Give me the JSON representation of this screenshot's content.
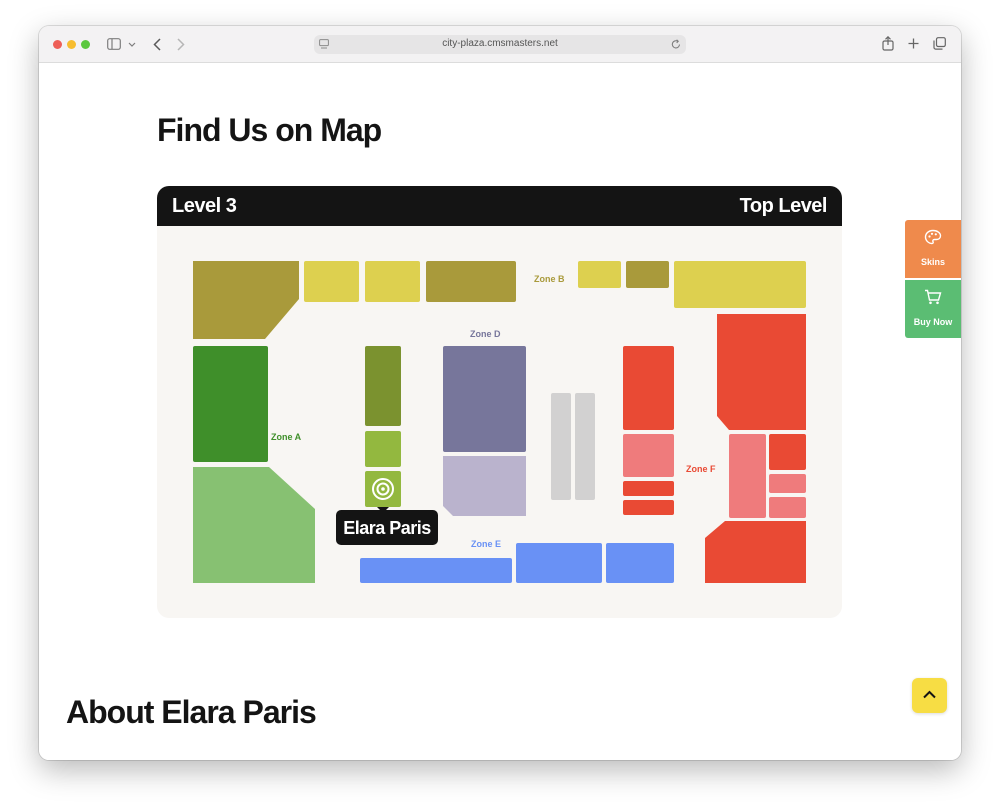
{
  "browser": {
    "url": "city-plaza.cmsmasters.net",
    "traffic_lights": {
      "close": "#ee5f57",
      "minimize": "#f7bd2f",
      "zoom": "#5bc73f"
    },
    "icons": [
      "sidebar-icon",
      "chevron-down-icon",
      "back-icon",
      "forward-icon",
      "page-icon",
      "reload-icon",
      "share-icon",
      "new-tab-icon",
      "tabs-icon"
    ]
  },
  "page": {
    "title": "Find Us on Map",
    "about_title": "About Elara Paris"
  },
  "map": {
    "level_label": "Level 3",
    "level_name": "Top Level",
    "zones": {
      "a": "Zone A",
      "b": "Zone B",
      "d": "Zone D",
      "e": "Zone E",
      "f": "Zone F"
    },
    "tooltip": "Elara Paris",
    "colors": {
      "zone_a": "#3f8f2a",
      "zone_a_light": "#87c172",
      "zone_b": "#ddd04f",
      "zone_b_dark": "#a99a3b",
      "zone_c": "#7b922f",
      "zone_c_light": "#93b83f",
      "zone_d": "#77769b",
      "zone_d_light": "#bab3cd",
      "zone_e": "#6991f5",
      "zone_f": "#e94a34",
      "zone_f_light": "#ef7b7c",
      "corridor": "#d2d1d1"
    }
  },
  "side_buttons": {
    "skins": {
      "label": "Skins",
      "icon": "palette-icon",
      "color": "#ef8a4c"
    },
    "buy": {
      "label": "Buy Now",
      "icon": "cart-icon",
      "color": "#5bbd73"
    }
  },
  "scroll_top": {
    "icon": "chevron-up-icon",
    "color": "#f7dd44"
  }
}
